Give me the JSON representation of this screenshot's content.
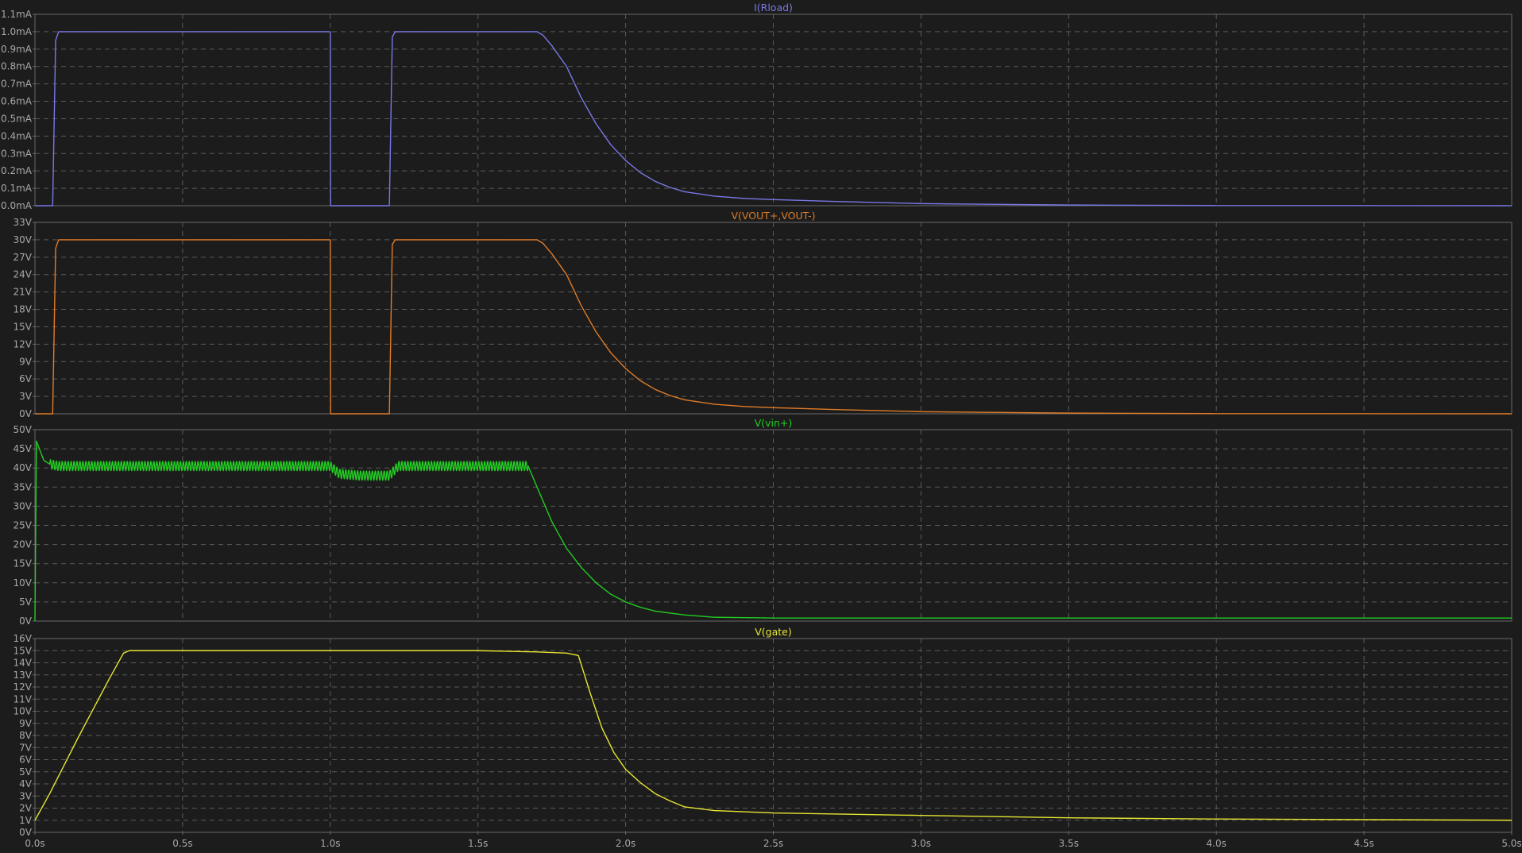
{
  "window": {
    "background": "#1c1c1c"
  },
  "chart_data": [
    {
      "type": "line",
      "title": "I(Rload)",
      "ylabel": "",
      "xlabel": "",
      "color": "#7878e6",
      "xlim": [
        0,
        5
      ],
      "ylim": [
        0,
        1.1
      ],
      "yticks": [
        0.0,
        0.1,
        0.2,
        0.3,
        0.4,
        0.5,
        0.6,
        0.7,
        0.8,
        0.9,
        1.0,
        1.1
      ],
      "ytick_labels": [
        "0.0mA",
        "0.1mA",
        "0.2mA",
        "0.3mA",
        "0.4mA",
        "0.5mA",
        "0.6mA",
        "0.7mA",
        "0.8mA",
        "0.9mA",
        "1.0mA",
        "1.1mA"
      ],
      "xticks": [
        0,
        0.5,
        1.0,
        1.5,
        2.0,
        2.5,
        3.0,
        3.5,
        4.0,
        4.5,
        5.0
      ],
      "xtick_labels": [
        "0.0s",
        "0.5s",
        "1.0s",
        "1.5s",
        "2.0s",
        "2.5s",
        "3.0s",
        "3.5s",
        "4.0s",
        "4.5s",
        "5.0s"
      ],
      "show_x_labels": false,
      "grid": true,
      "series": [
        {
          "x": [
            0,
            0.06,
            0.07,
            0.08,
            1.0,
            1.001,
            1.2,
            1.21,
            1.22,
            1.7,
            1.72,
            1.75,
            1.8,
            1.85,
            1.9,
            1.95,
            2.0,
            2.05,
            2.1,
            2.15,
            2.2,
            2.3,
            2.4,
            2.5,
            2.7,
            3.0,
            3.5,
            4.0,
            5.0
          ],
          "y": [
            0,
            0,
            0.95,
            1.0,
            1.0,
            0,
            0,
            0.97,
            1.0,
            1.0,
            0.98,
            0.92,
            0.8,
            0.62,
            0.47,
            0.35,
            0.26,
            0.19,
            0.14,
            0.105,
            0.08,
            0.055,
            0.042,
            0.035,
            0.025,
            0.012,
            0.004,
            0.001,
            0
          ]
        }
      ]
    },
    {
      "type": "line",
      "title": "V(VOUT+,VOUT-)",
      "ylabel": "",
      "xlabel": "",
      "color": "#e07c28",
      "xlim": [
        0,
        5
      ],
      "ylim": [
        0,
        33
      ],
      "yticks": [
        0,
        3,
        6,
        9,
        12,
        15,
        18,
        21,
        24,
        27,
        30,
        33
      ],
      "ytick_labels": [
        "0V",
        "3V",
        "6V",
        "9V",
        "12V",
        "15V",
        "18V",
        "21V",
        "24V",
        "27V",
        "30V",
        "33V"
      ],
      "xticks": [
        0,
        0.5,
        1.0,
        1.5,
        2.0,
        2.5,
        3.0,
        3.5,
        4.0,
        4.5,
        5.0
      ],
      "xtick_labels": [
        "0.0s",
        "0.5s",
        "1.0s",
        "1.5s",
        "2.0s",
        "2.5s",
        "3.0s",
        "3.5s",
        "4.0s",
        "4.5s",
        "5.0s"
      ],
      "show_x_labels": false,
      "grid": true,
      "series": [
        {
          "x": [
            0,
            0.06,
            0.07,
            0.08,
            1.0,
            1.001,
            1.2,
            1.21,
            1.22,
            1.7,
            1.72,
            1.75,
            1.8,
            1.85,
            1.9,
            1.95,
            2.0,
            2.05,
            2.1,
            2.15,
            2.2,
            2.3,
            2.4,
            2.5,
            2.7,
            3.0,
            3.5,
            4.0,
            5.0
          ],
          "y": [
            0,
            0,
            28.5,
            30,
            30,
            0,
            0,
            29.2,
            30,
            30,
            29.4,
            27.6,
            24,
            18.6,
            14.1,
            10.5,
            7.8,
            5.7,
            4.2,
            3.15,
            2.4,
            1.65,
            1.26,
            1.05,
            0.75,
            0.36,
            0.12,
            0.03,
            0
          ]
        }
      ]
    },
    {
      "type": "line",
      "title": "V(vin+)",
      "ylabel": "",
      "xlabel": "",
      "color": "#22cc22",
      "xlim": [
        0,
        5
      ],
      "ylim": [
        0,
        50
      ],
      "yticks": [
        0,
        5,
        10,
        15,
        20,
        25,
        30,
        35,
        40,
        45,
        50
      ],
      "ytick_labels": [
        "0V",
        "5V",
        "10V",
        "15V",
        "20V",
        "25V",
        "30V",
        "35V",
        "40V",
        "45V",
        "50V"
      ],
      "xticks": [
        0,
        0.5,
        1.0,
        1.5,
        2.0,
        2.5,
        3.0,
        3.5,
        4.0,
        4.5,
        5.0
      ],
      "xtick_labels": [
        "0.0s",
        "0.5s",
        "1.0s",
        "1.5s",
        "2.0s",
        "2.5s",
        "3.0s",
        "3.5s",
        "4.0s",
        "4.5s",
        "5.0s"
      ],
      "show_x_labels": false,
      "grid": true,
      "ripple": {
        "amplitude": 1.2,
        "cycles_per_second": 100,
        "t_start": 0.05,
        "t_end": 1.67
      },
      "series": [
        {
          "x": [
            0,
            0.005,
            0.01,
            0.02,
            0.03,
            0.05,
            0.08,
            0.15,
            1.0,
            1.03,
            1.1,
            1.2,
            1.23,
            1.3,
            1.67,
            1.7,
            1.75,
            1.8,
            1.85,
            1.9,
            1.95,
            2.0,
            2.05,
            2.1,
            2.2,
            2.3,
            2.5,
            3.0,
            4.0,
            5.0
          ],
          "y": [
            0,
            47,
            46,
            44,
            42,
            41,
            40.5,
            40.5,
            40.5,
            38.5,
            38,
            38,
            40.5,
            40.5,
            40.5,
            35,
            26,
            19,
            14,
            10,
            7,
            5,
            3.6,
            2.6,
            1.6,
            1.0,
            0.8,
            0.8,
            0.8,
            0.8
          ]
        }
      ]
    },
    {
      "type": "line",
      "title": "V(gate)",
      "ylabel": "",
      "xlabel": "",
      "color": "#e6e632",
      "xlim": [
        0,
        5
      ],
      "ylim": [
        0,
        16
      ],
      "yticks": [
        0,
        1,
        2,
        3,
        4,
        5,
        6,
        7,
        8,
        9,
        10,
        11,
        12,
        13,
        14,
        15,
        16
      ],
      "ytick_labels": [
        "0V",
        "1V",
        "2V",
        "3V",
        "4V",
        "5V",
        "6V",
        "7V",
        "8V",
        "9V",
        "10V",
        "11V",
        "12V",
        "13V",
        "14V",
        "15V",
        "16V"
      ],
      "xticks": [
        0,
        0.5,
        1.0,
        1.5,
        2.0,
        2.5,
        3.0,
        3.5,
        4.0,
        4.5,
        5.0
      ],
      "xtick_labels": [
        "0.0s",
        "0.5s",
        "1.0s",
        "1.5s",
        "2.0s",
        "2.5s",
        "3.0s",
        "3.5s",
        "4.0s",
        "4.5s",
        "5.0s"
      ],
      "show_x_labels": true,
      "grid": true,
      "series": [
        {
          "x": [
            0,
            0.05,
            0.1,
            0.15,
            0.2,
            0.25,
            0.3,
            0.32,
            0.35,
            1.0,
            1.5,
            1.7,
            1.8,
            1.84,
            1.88,
            1.92,
            1.96,
            2.0,
            2.05,
            2.1,
            2.15,
            2.2,
            2.3,
            2.5,
            3.0,
            3.5,
            4.0,
            4.5,
            5.0
          ],
          "y": [
            1,
            3.2,
            5.6,
            8.0,
            10.3,
            12.6,
            14.8,
            15,
            15,
            15,
            15,
            14.9,
            14.8,
            14.6,
            11.5,
            8.6,
            6.6,
            5.2,
            4.1,
            3.2,
            2.6,
            2.1,
            1.8,
            1.6,
            1.4,
            1.2,
            1.1,
            1.05,
            1.0
          ]
        }
      ]
    }
  ]
}
